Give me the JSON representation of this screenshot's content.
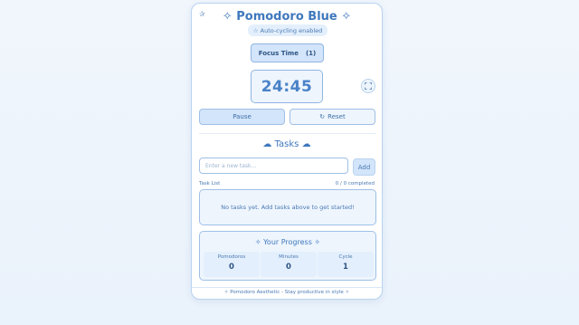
{
  "app": {
    "corner_icon": "star-icon",
    "title": "✧ Pomodoro Blue ✧",
    "badge": "☆ Auto-cycling enabled"
  },
  "timer": {
    "mode_label": "Focus Time",
    "mode_count": "(1)",
    "time": "24:45",
    "fullscreen_icon": "fullscreen-icon"
  },
  "controls": {
    "pause_label": "Pause",
    "reset_icon": "↻",
    "reset_label": "Reset"
  },
  "tasks": {
    "title": "☁ Tasks ☁",
    "input_placeholder": "Enter a new task...",
    "add_label": "Add",
    "list_label": "Task List",
    "count": "0 / 0 completed",
    "empty_message": "No tasks yet. Add tasks above to get started!"
  },
  "progress": {
    "title": "✧ Your Progress ✧",
    "stats": [
      {
        "label": "Pomodoros",
        "value": "0"
      },
      {
        "label": "Minutes",
        "value": "0"
      },
      {
        "label": "Cycle",
        "value": "1"
      }
    ]
  },
  "footer": {
    "text": "✧ Pomodoro Aesthetic - Stay productive in style ✧"
  },
  "colors": {
    "accent": "#3f78bd",
    "panel": "#eef5fd",
    "border": "#9fbfe6"
  }
}
